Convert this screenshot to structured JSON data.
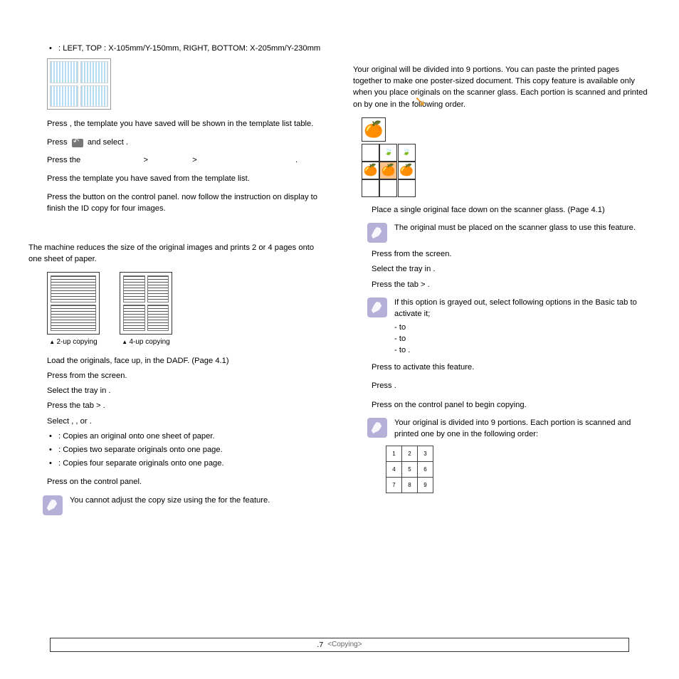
{
  "left": {
    "bullet_lead": "•",
    "bullet1": ": LEFT, TOP : X-105mm/Y-150mm, RIGHT, BOTTOM: X-205mm/Y-230mm",
    "press_template": "Press       , the template you have saved will be shown in the template list table.",
    "press_back": "Press",
    "press_back_tail": "and select         .",
    "breadcrumb_lead": "Press the",
    "sep": ">",
    "breadcrumb_end": ".",
    "press_saved": "Press the template you have saved from the template list.",
    "press_start": "Press the          button on the control panel. now follow the instruction on display to finish the ID copy for four images.",
    "nup_intro": "The machine reduces the size of the original images and prints 2 or 4 pages onto one sheet of paper.",
    "cap2": "2-up copying",
    "cap4": "4-up copying",
    "steps": [
      "Load the originals, face up, in the DADF. (Page 4.1)",
      "Press          from the          screen.",
      "Select the tray in                   .",
      "Press the               tab >          .",
      "Select      ,       , or        ."
    ],
    "opts": [
      ": Copies an original onto one sheet of paper.",
      ": Copies two separate originals onto one page.",
      ": Copies four separate originals onto one page."
    ],
    "press_ctrl": "Press          on the control panel.",
    "note": "You cannot adjust the copy size using the                        for the          feature."
  },
  "right": {
    "intro": "Your original will be divided into 9 portions. You can paste the printed pages together to make one poster-sized document. This copy feature is available only when you place originals on the scanner glass. Each portion is scanned and printed on by one in the following order.",
    "place": "Place a single original face down on the scanner glass. (Page 4.1)",
    "note1": "The original must be placed on the scanner glass to use this feature.",
    "steps": [
      "Press          from the             screen.",
      "Select the tray in                   .",
      "Press the               tab >                  ."
    ],
    "note2_a": "If this option is grayed out, select following options in the Basic tab to activate it;",
    "note2_b": "-               to",
    "note2_c": "-                         to",
    "note2_d": "-                         to      .",
    "activate": "Press        to activate this feature.",
    "press_ok": "Press       .",
    "press_begin": "Press           on the control panel to begin copying.",
    "note3": "Your original is divided into 9 portions. Each portion is scanned and printed one by one in the following order:",
    "order": [
      [
        "1",
        "2",
        "3"
      ],
      [
        "4",
        "5",
        "6"
      ],
      [
        "7",
        "8",
        "9"
      ]
    ]
  },
  "footer": {
    "page": ".7",
    "section": "<Copying>"
  }
}
